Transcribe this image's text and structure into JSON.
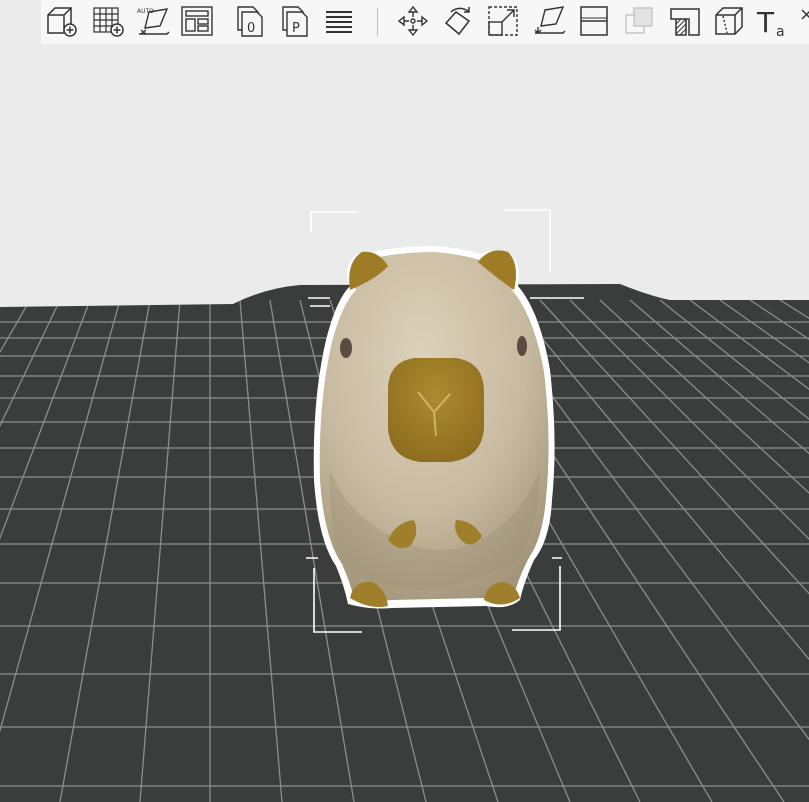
{
  "toolbar": {
    "buttons": [
      {
        "name": "add-object-button",
        "icon": "cube-plus-icon"
      },
      {
        "name": "add-plate-button",
        "icon": "grid-plus-icon"
      },
      {
        "name": "auto-orient-button",
        "icon": "auto-orient-icon",
        "badge": "AUTO"
      },
      {
        "name": "arrange-button",
        "icon": "arrange-layout-icon"
      },
      {
        "name": "plate-0-button",
        "icon": "page-0-icon",
        "glyph": "0"
      },
      {
        "name": "plate-p-button",
        "icon": "page-p-icon",
        "glyph": "P"
      },
      {
        "name": "layers-button",
        "icon": "layers-list-icon"
      },
      {
        "name": "move-button",
        "icon": "move-arrows-icon"
      },
      {
        "name": "rotate-button",
        "icon": "rotate-icon"
      },
      {
        "name": "scale-button",
        "icon": "scale-icon"
      },
      {
        "name": "lay-on-face-button",
        "icon": "lay-on-face-icon"
      },
      {
        "name": "cut-button",
        "icon": "cut-icon"
      },
      {
        "name": "boolean-button",
        "icon": "boolean-icon"
      },
      {
        "name": "support-paint-button",
        "icon": "support-paint-icon"
      },
      {
        "name": "seam-paint-button",
        "icon": "seam-cube-icon"
      },
      {
        "name": "text-button",
        "icon": "text-shape-icon",
        "glyph": "T",
        "sub": "a"
      },
      {
        "name": "measure-button",
        "icon": "measure-icon"
      }
    ]
  },
  "viewport": {
    "background_color": "#ebebeb",
    "plate_color": "#3b3d3c",
    "grid_color": "#8b8e8b",
    "model": {
      "name": "capybara",
      "body_color": "#c9bca3",
      "accent_color": "#a07f2a",
      "outline_color": "#ffffff"
    }
  }
}
